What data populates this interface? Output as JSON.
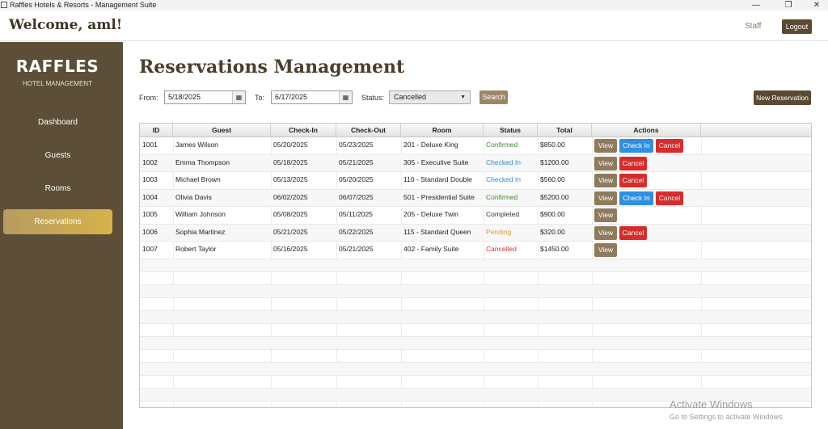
{
  "window": {
    "title": "Raffles Hotels & Resorts - Management Suite",
    "min": "—",
    "max": "❐",
    "close": "✕"
  },
  "header": {
    "welcome": "Welcome, aml!",
    "role": "Staff",
    "logout_label": "Logout"
  },
  "sidebar": {
    "brand": "RAFFLES",
    "subtitle": "HOTEL MANAGEMENT",
    "items": [
      {
        "label": "Dashboard",
        "active": false
      },
      {
        "label": "Guests",
        "active": false
      },
      {
        "label": "Rooms",
        "active": false
      },
      {
        "label": "Reservations",
        "active": true
      }
    ]
  },
  "main": {
    "title": "Reservations Management",
    "filters": {
      "from_label": "From:",
      "from_value": "5/18/2025",
      "to_label": "To:",
      "to_value": "6/17/2025",
      "status_label": "Status:",
      "status_value": "Cancelled",
      "search_label": "Search",
      "new_label": "New Reservation"
    },
    "table": {
      "columns": [
        "ID",
        "Guest",
        "Check-In",
        "Check-Out",
        "Room",
        "Status",
        "Total",
        "Actions"
      ],
      "rows": [
        {
          "id": "1001",
          "guest": "James Wilson",
          "checkin": "05/20/2025",
          "checkout": "05/23/2025",
          "room": "201 - Deluxe King",
          "status": "Confirmed",
          "total": "$850.00",
          "actions": [
            "View",
            "Check In",
            "Cancel"
          ]
        },
        {
          "id": "1002",
          "guest": "Emma Thompson",
          "checkin": "05/18/2025",
          "checkout": "05/21/2025",
          "room": "305 - Executive Suite",
          "status": "Checked In",
          "total": "$1200.00",
          "actions": [
            "View",
            "Cancel"
          ]
        },
        {
          "id": "1003",
          "guest": "Michael Brown",
          "checkin": "05/13/2025",
          "checkout": "05/20/2025",
          "room": "110 - Standard Double",
          "status": "Checked In",
          "total": "$560.00",
          "actions": [
            "View",
            "Cancel"
          ]
        },
        {
          "id": "1004",
          "guest": "Olivia Davis",
          "checkin": "06/02/2025",
          "checkout": "06/07/2025",
          "room": "501 - Presidential Suite",
          "status": "Confirmed",
          "total": "$5200.00",
          "actions": [
            "View",
            "Check In",
            "Cancel"
          ]
        },
        {
          "id": "1005",
          "guest": "William Johnson",
          "checkin": "05/08/2025",
          "checkout": "05/11/2025",
          "room": "205 - Deluxe Twin",
          "status": "Completed",
          "total": "$900.00",
          "actions": [
            "View"
          ]
        },
        {
          "id": "1006",
          "guest": "Sophia Martinez",
          "checkin": "05/21/2025",
          "checkout": "05/22/2025",
          "room": "115 - Standard Queen",
          "status": "Pending",
          "total": "$320.00",
          "actions": [
            "View",
            "Cancel"
          ]
        },
        {
          "id": "1007",
          "guest": "Robert Taylor",
          "checkin": "05/16/2025",
          "checkout": "05/21/2025",
          "room": "402 - Family Suite",
          "status": "Cancelled",
          "total": "$1450.00",
          "actions": [
            "View"
          ]
        }
      ]
    }
  },
  "watermark": {
    "line1": "Activate Windows",
    "line2": "Go to Settings to activate Windows."
  },
  "colors": {
    "sidebar": "#5d4f37",
    "accent": "#d6b24a",
    "primary_button": "#5b4a32",
    "view_button": "#8d7b5c",
    "checkin_button": "#2f8fe0",
    "cancel_button": "#d82b2b"
  }
}
